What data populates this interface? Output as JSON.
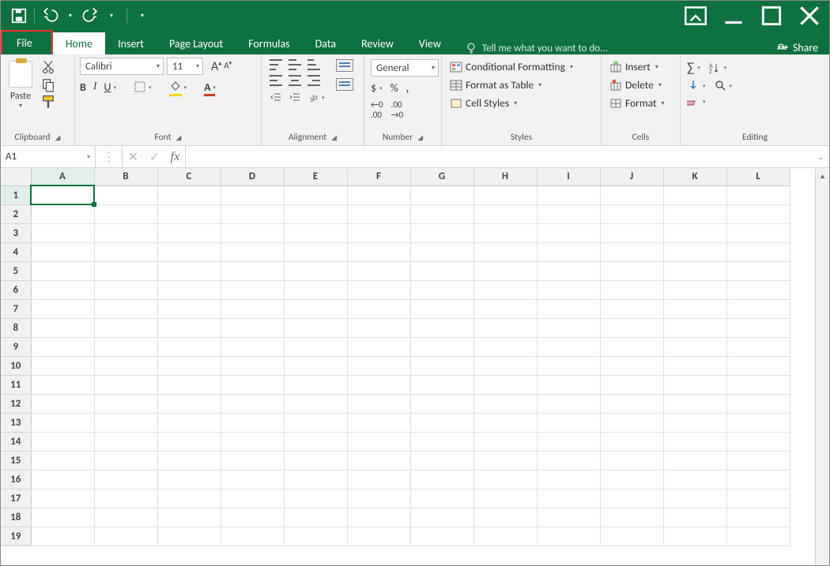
{
  "tabs": {
    "file": "File",
    "home": "Home",
    "insert": "Insert",
    "pagelayout": "Page Layout",
    "formulas": "Formulas",
    "data": "Data",
    "review": "Review",
    "view": "View"
  },
  "tellme": "Tell me what you want to do...",
  "share": "Share",
  "ribbon": {
    "clipboard": {
      "label": "Clipboard",
      "paste": "Paste"
    },
    "font": {
      "label": "Font",
      "name": "Calibri",
      "size": "11",
      "bold": "B",
      "italic": "I",
      "underline": "U"
    },
    "alignment": {
      "label": "Alignment"
    },
    "number": {
      "label": "Number",
      "format": "General",
      "currency": "$",
      "percent": "%",
      "comma": ","
    },
    "styles": {
      "label": "Styles",
      "cond": "Conditional Formatting",
      "table": "Format as Table",
      "cell": "Cell Styles"
    },
    "cells": {
      "label": "Cells",
      "insert": "Insert",
      "delete": "Delete",
      "format": "Format"
    },
    "editing": {
      "label": "Editing"
    }
  },
  "namebox": "A1",
  "columns": [
    "A",
    "B",
    "C",
    "D",
    "E",
    "F",
    "G",
    "H",
    "I",
    "J",
    "K",
    "L"
  ],
  "rows": [
    "1",
    "2",
    "3",
    "4",
    "5",
    "6",
    "7",
    "8",
    "9",
    "10",
    "11",
    "12",
    "13",
    "14",
    "15",
    "16",
    "17",
    "18",
    "19"
  ]
}
